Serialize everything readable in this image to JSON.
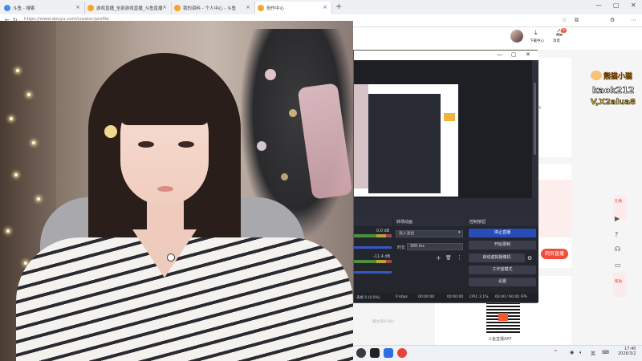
{
  "browser": {
    "tabs": [
      {
        "label": "斗鱼 - 搜索"
      },
      {
        "label": "游戏直播_全部游戏直播_斗鱼直播"
      },
      {
        "label": "我的资料 - 个人中心 - 斗鱼"
      },
      {
        "label": "创作中心"
      }
    ],
    "url": "https://www.douyu.com/creator/profile",
    "new_tab": "+"
  },
  "page": {
    "download_label": "下载中心",
    "message_label": "消息",
    "message_count": "8",
    "value_45": "45",
    "go_live_button": "网页直播",
    "qr_label": "斗鱼直播APP",
    "bottom_small": "随之风(5.0k)"
  },
  "promo": {
    "line1": "熊猫小猫",
    "line2": "kaok212",
    "line3": "V,X2alua8"
  },
  "right_rail": {
    "items": [
      "礼物",
      "攻略",
      "帮助"
    ]
  },
  "obs": {
    "transitions": {
      "header": "转场动画",
      "type_value": "淡入淡出",
      "duration_label": "时长",
      "duration_value": "300 ms"
    },
    "controls": {
      "header": "控制按钮",
      "stop_stream": "停止直播",
      "start_record": "开始录制",
      "virtual_camera": "启动虚拟摄像机",
      "studio_mode": "工作室模式",
      "settings": "设置"
    },
    "mixer": {
      "level1": "0.0 dB",
      "level2": "-11.4 dB"
    },
    "status": {
      "dropped": "丢帧 0 (0.0%)",
      "bitrate": "0 kbps",
      "stream_time": "00:00:00",
      "record_time": "00:00:00",
      "cpu": "CPU: 2.1%",
      "fps": "60.00 / 60.00 FPS"
    }
  },
  "taskbar": {
    "lang": "英",
    "time": "17:40",
    "date": "2026/3/2"
  },
  "colors": {
    "accent_red": "#f34b3a",
    "obs_primary": "#284cb8",
    "obs_bg": "#2b2e38"
  }
}
